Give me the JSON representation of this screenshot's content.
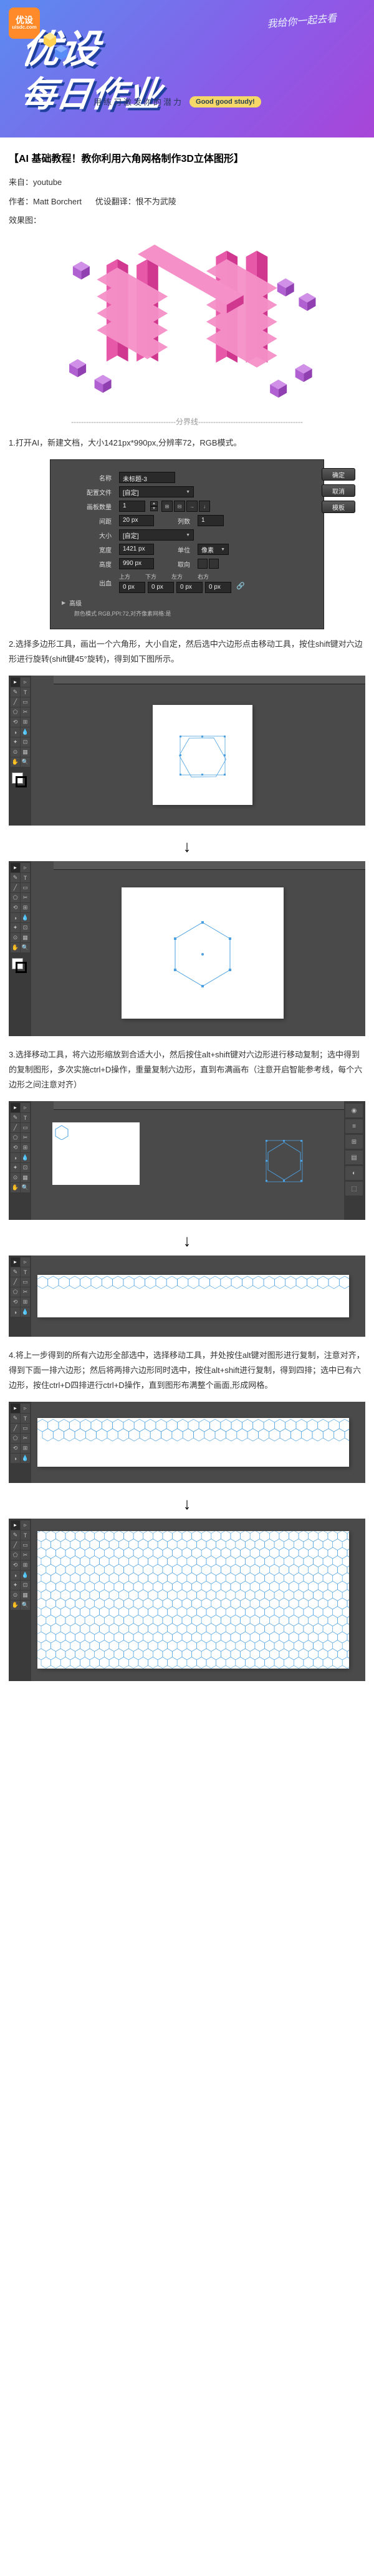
{
  "header": {
    "logo_text": "优设",
    "logo_sub": "uisdc.com",
    "slant": "我给你一起去看",
    "title_line1": "优设",
    "title_line2": "每日作业",
    "subtitle": "用练习激发你的潜力",
    "badge": "Good good study!"
  },
  "article": {
    "title": "【AI 基础教程！教你利用六角网格制作3D立体图形】",
    "source_label": "来自：",
    "source_value": "youtube",
    "author_label": "作者：",
    "author_value": "Matt Borchert",
    "translator_label": "优设翻译：",
    "translator_value": "恨不为武陵",
    "result_label": "效果图："
  },
  "divider_text": "------------------------------------------分界线------------------------------------------",
  "steps": {
    "s1": "1.打开AI，新建文档，大小1421px*990px,分辨率72，RGB模式。",
    "s2": "2.选择多边形工具，画出一个六角形，大小自定，然后选中六边形点击移动工具，按住shift键对六边形进行旋转(shift键45°旋转)，得到如下图所示。",
    "s3": "3.选择移动工具，将六边形缩放到合适大小，然后按住alt+shift键对六边形进行移动复制；选中得到的复制图形，多次实施ctrl+D操作，重量复制六边形，直到布满画布（注意开启智能参考线，每个六边形之间注意对齐）",
    "s4": "4.将上一步得到的所有六边形全部选中，选择移动工具，并处按住alt键对图形进行复制，注意对齐，得到下面一排六边形；然后将两排六边形同时选中，按住alt+shift进行复制，得到四排；选中已有六边形，按住ctrl+D四排进行ctrl+D操作，直到图形布满整个画面,形成网格。"
  },
  "dialog": {
    "name_label": "名称",
    "name_value": "未标题-3",
    "preset_label": "配置文件",
    "preset_value": "[自定]",
    "artboards_label": "画板数量",
    "artboards_value": "1",
    "spacing_label": "间距",
    "spacing_value": "20 px",
    "cols_label": "列数",
    "cols_value": "1",
    "size_label": "大小",
    "size_value": "[自定]",
    "width_label": "宽度",
    "width_value": "1421 px",
    "unit_label": "单位",
    "unit_value": "像素",
    "height_label": "高度",
    "height_value": "990 px",
    "orient_label": "取向",
    "bleed_label": "出血",
    "bleed_top": "上方",
    "bleed_bottom": "下方",
    "bleed_left": "左方",
    "bleed_right": "右方",
    "bleed_val": "0 px",
    "advanced_label": "高级",
    "mode_label": "颜色模式 RGB,PPI:72,对齐像素网格:是",
    "ok": "确定",
    "cancel": "取消",
    "template": "模板"
  },
  "tools": {
    "t0": "▸",
    "t1": "▹",
    "t2": "✎",
    "t3": "T",
    "t4": "╱",
    "t5": "▭",
    "t6": "⬠",
    "t7": "✂",
    "t8": "⟲",
    "t9": "⊞",
    "t10": "◑",
    "t11": "💧",
    "t12": "✦",
    "t13": "⊡",
    "t14": "⊙",
    "t15": "▦",
    "t16": "✋",
    "t17": "🔍"
  },
  "panels": {
    "p0": "◉",
    "p1": "≡",
    "p2": "⊞",
    "p3": "▤",
    "p4": "◐",
    "p5": "⬚",
    "p6": "✦"
  }
}
